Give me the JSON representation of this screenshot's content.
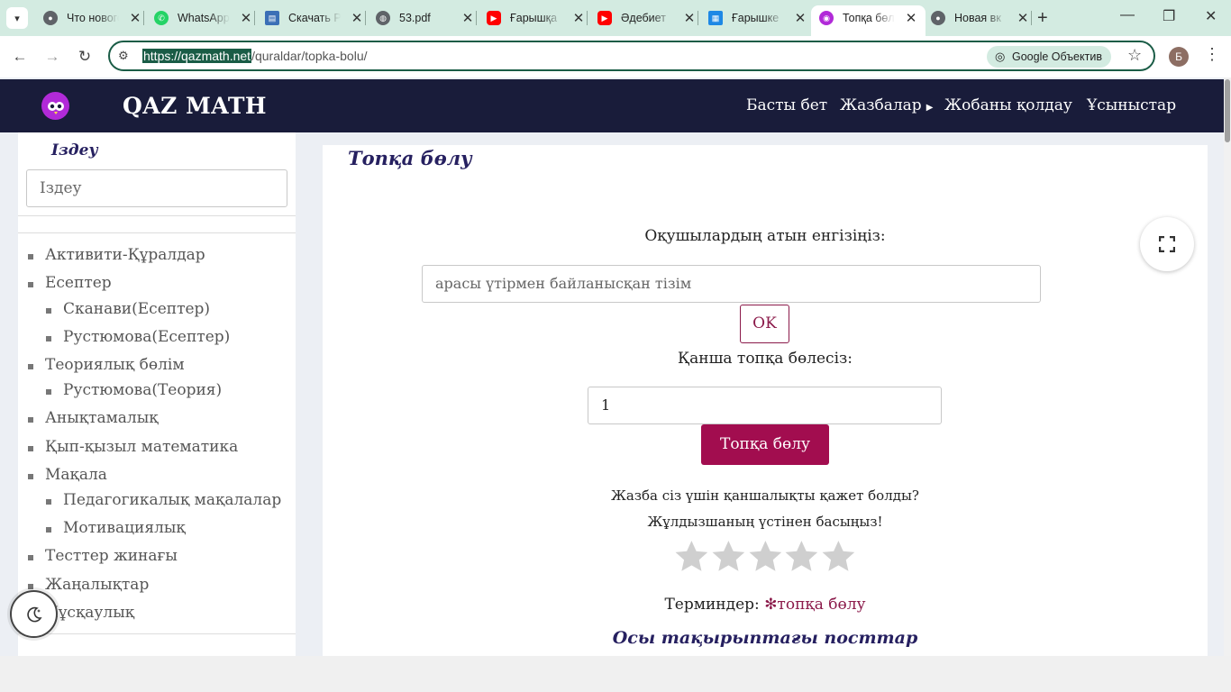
{
  "browser": {
    "tabs": [
      {
        "title": "Что нового",
        "icon": "chrome-icon",
        "color": "#5f6368"
      },
      {
        "title": "WhatsApp",
        "icon": "whatsapp-icon",
        "color": "#25d366"
      },
      {
        "title": "Скачать P",
        "icon": "book-icon",
        "color": "#3b6fb6"
      },
      {
        "title": "53.pdf",
        "icon": "globe-icon",
        "color": "#5f6368"
      },
      {
        "title": "Ғарышқа",
        "icon": "youtube-icon",
        "color": "#ff0000"
      },
      {
        "title": "Әдебиет",
        "icon": "youtube-icon",
        "color": "#ff0000"
      },
      {
        "title": "Ғарышке",
        "icon": "grid-icon",
        "color": "#1e88e5"
      },
      {
        "title": "Топқа бөл",
        "icon": "owl-icon",
        "color": "#b12ad8",
        "active": true
      },
      {
        "title": "Новая вк",
        "icon": "chrome-icon",
        "color": "#5f6368"
      }
    ],
    "url_host": "https://qazmath.net",
    "url_path": "/quraldar/topka-bolu/",
    "lens_label": "Google Объектив",
    "profile_initial": "Б"
  },
  "site": {
    "title": "QAZ MATH",
    "nav": [
      "Басты бет",
      "Жазбалар",
      "Жобаны қолдау",
      "Ұсыныстар"
    ]
  },
  "sidebar": {
    "search_title": "Іздеу",
    "search_placeholder": "Іздеу",
    "items": [
      {
        "label": "Активити-Құралдар",
        "level": 0
      },
      {
        "label": "Есептер",
        "level": 0
      },
      {
        "label": "Сканави(Есептер)",
        "level": 1
      },
      {
        "label": "Рустюмова(Есептер)",
        "level": 1
      },
      {
        "label": "Теориялық бөлім",
        "level": 0
      },
      {
        "label": "Рустюмова(Теория)",
        "level": 1
      },
      {
        "label": "Анықтамалық",
        "level": 0
      },
      {
        "label": "Қып-қызыл математика",
        "level": 0
      },
      {
        "label": "Мақала",
        "level": 0
      },
      {
        "label": "Педагогикалық мақалалар",
        "level": 1
      },
      {
        "label": "Мотивациялық",
        "level": 1
      },
      {
        "label": "Тесттер жинағы",
        "level": 0
      },
      {
        "label": "Жаңалықтар",
        "level": 0
      },
      {
        "label": "Нұсқаулық",
        "level": 0
      }
    ]
  },
  "main": {
    "page_title": "Топқа бөлу",
    "names_label": "Оқушылардың атын енгізіңіз:",
    "names_placeholder": "арасы үтірмен байланысқан тізім",
    "ok_label": "OK",
    "count_label": "Қанша топқа бөлесіз:",
    "count_value": "1",
    "split_button": "Топқа бөлу",
    "rating_question": "Жазба сіз үшін қаншалықты қажет болды?",
    "rating_hint": "Жұлдызшаның үстінен басыңыз!",
    "rating_stars": 5,
    "terms_label": "Терминдер:",
    "term_tag": "✻топқа бөлу",
    "related_title": "Осы тақырыптағы посттар"
  },
  "colors": {
    "header_bg": "#191c3a",
    "accent": "#a20d4f",
    "title_color": "#262060",
    "chrome_tabbar": "#d3ebe1",
    "chrome_accent": "#1a5c46"
  }
}
